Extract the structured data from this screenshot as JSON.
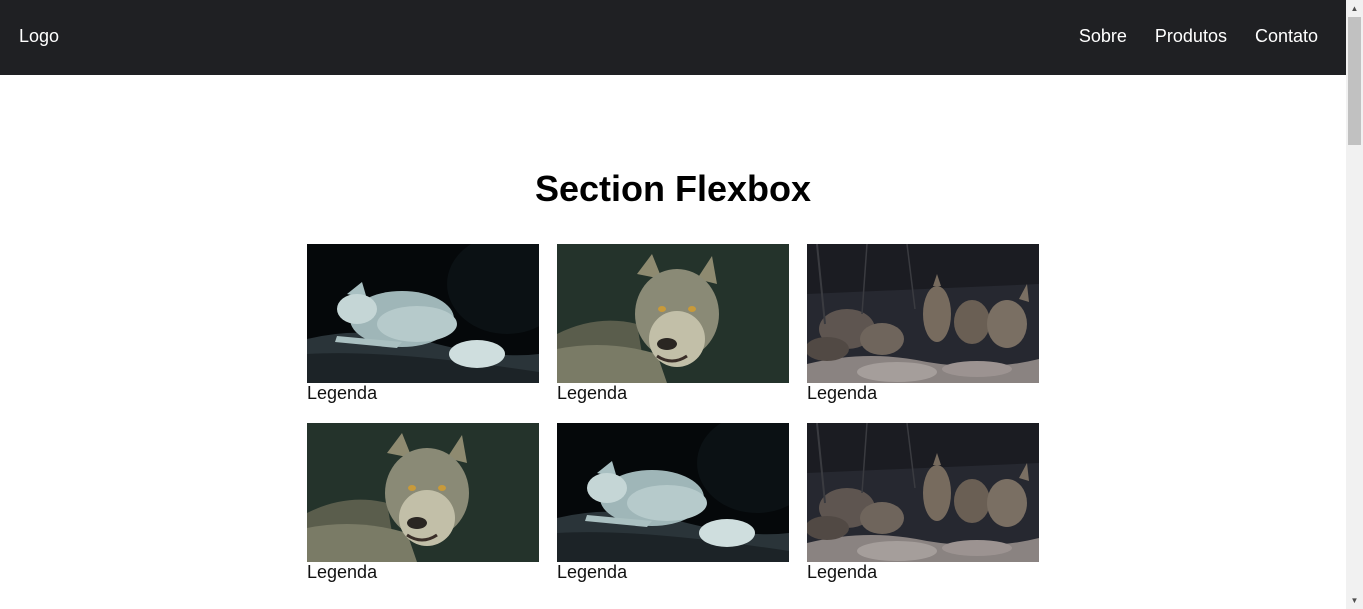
{
  "header": {
    "logo": "Logo",
    "nav": [
      {
        "label": "Sobre"
      },
      {
        "label": "Produtos"
      },
      {
        "label": "Contato"
      }
    ]
  },
  "section": {
    "title": "Section Flexbox"
  },
  "gallery": [
    {
      "caption": "Legenda",
      "image": "white-wolf-lying-photo"
    },
    {
      "caption": "Legenda",
      "image": "gray-wolf-portrait-photo"
    },
    {
      "caption": "Legenda",
      "image": "wolf-pack-rocks-photo"
    },
    {
      "caption": "Legenda",
      "image": "gray-wolf-portrait-photo"
    },
    {
      "caption": "Legenda",
      "image": "white-wolf-lying-photo"
    },
    {
      "caption": "Legenda",
      "image": "wolf-pack-rocks-photo"
    }
  ],
  "colors": {
    "header_bg": "#1f2023",
    "header_text": "#ffffff",
    "page_bg": "#ffffff"
  }
}
